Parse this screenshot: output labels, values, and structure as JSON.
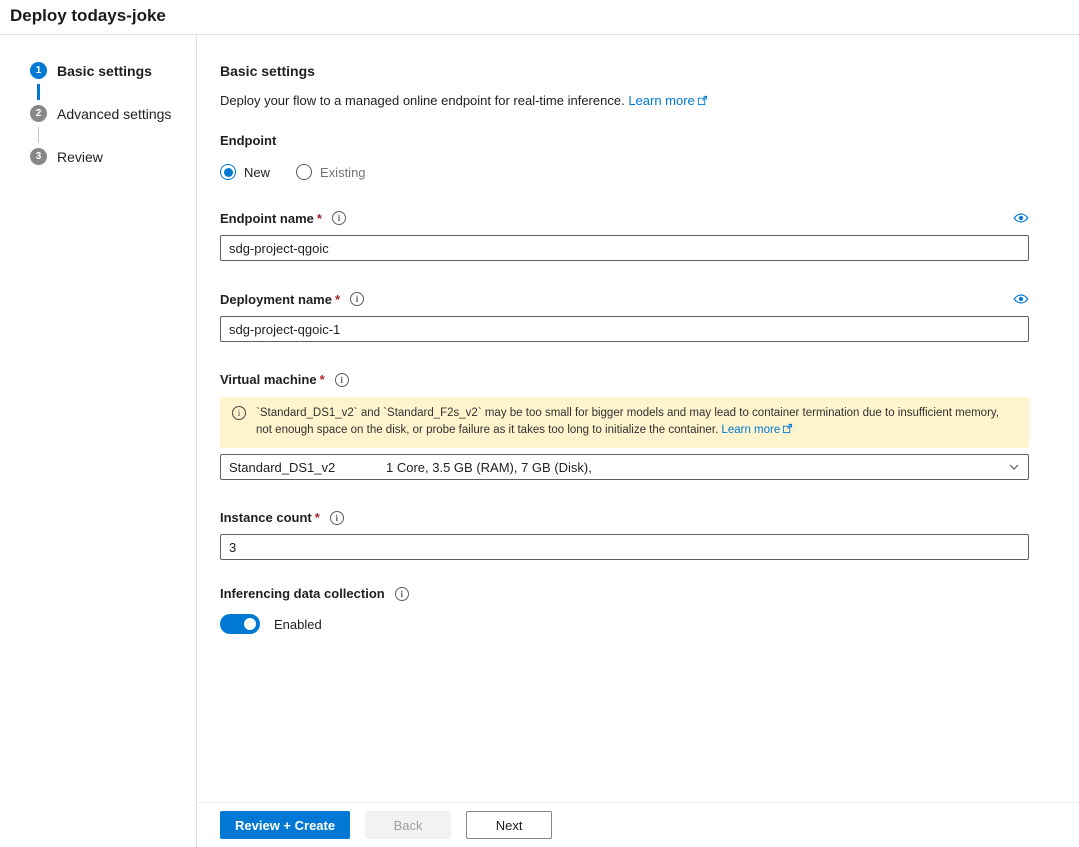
{
  "page": {
    "title": "Deploy todays-joke"
  },
  "wizard": {
    "steps": [
      {
        "number": "1",
        "label": "Basic settings",
        "state": "active"
      },
      {
        "number": "2",
        "label": "Advanced settings",
        "state": "pending"
      },
      {
        "number": "3",
        "label": "Review",
        "state": "pending"
      }
    ]
  },
  "main": {
    "heading": "Basic settings",
    "description": "Deploy your flow to a managed online endpoint for real-time inference.",
    "description_link": "Learn more",
    "endpoint": {
      "label": "Endpoint",
      "options": [
        {
          "label": "New",
          "selected": true
        },
        {
          "label": "Existing",
          "selected": false
        }
      ]
    },
    "endpoint_name": {
      "label": "Endpoint name",
      "required_mark": "*",
      "value": "sdg-project-qgoic"
    },
    "deployment_name": {
      "label": "Deployment name",
      "required_mark": "*",
      "value": "sdg-project-qgoic-1"
    },
    "virtual_machine": {
      "label": "Virtual machine",
      "required_mark": "*",
      "warning_text": "`Standard_DS1_v2` and `Standard_F2s_v2` may be too small for bigger models and may lead to container termination due to insufficient memory, not enough space on the disk, or probe failure as it takes too long to initialize the container.",
      "warning_link": "Learn more",
      "selected_name": "Standard_DS1_v2",
      "selected_specs": "1 Core, 3.5 GB (RAM), 7 GB (Disk),"
    },
    "instance_count": {
      "label": "Instance count",
      "required_mark": "*",
      "value": "3"
    },
    "data_collection": {
      "label": "Inferencing data collection",
      "toggle_state": "Enabled",
      "enabled": true
    }
  },
  "footer": {
    "review_create_label": "Review + Create",
    "back_label": "Back",
    "next_label": "Next"
  },
  "colors": {
    "primary": "#0078d4",
    "warning_bg": "#fff4ce",
    "link": "#0078d4"
  }
}
